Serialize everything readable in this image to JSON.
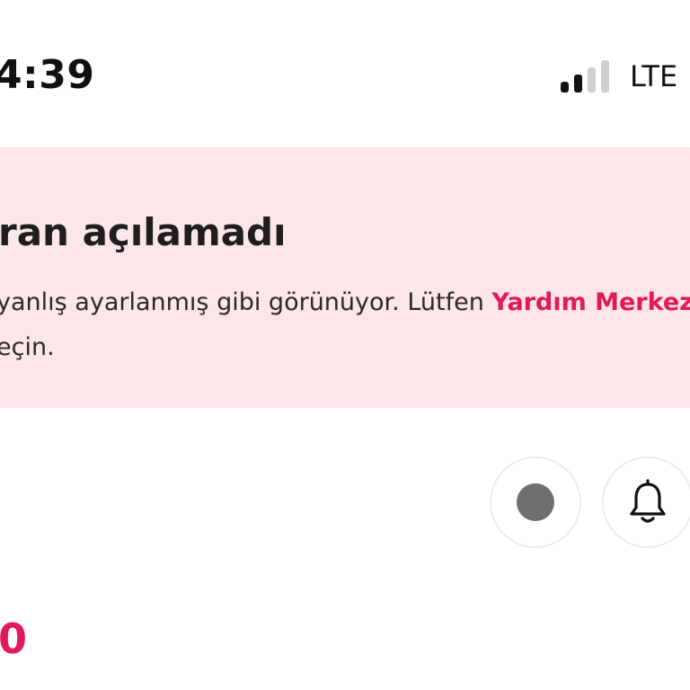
{
  "status_bar": {
    "time": "4:39",
    "network": "LTE",
    "signal_bars_active": 2,
    "signal_bars_total": 4
  },
  "error_banner": {
    "title": "ran açılamadı",
    "body_line1_prefix": "yanlış ayarlanmış gibi görünüyor. Lütfen ",
    "help_link": "Yardım Merkez",
    "body_line2": "eçin.",
    "background_color": "#fce6e8",
    "link_color": "#e2195a"
  },
  "actions": {
    "record_icon": "record-dot-icon",
    "bell_icon": "bell-icon"
  },
  "partial_value": "0"
}
